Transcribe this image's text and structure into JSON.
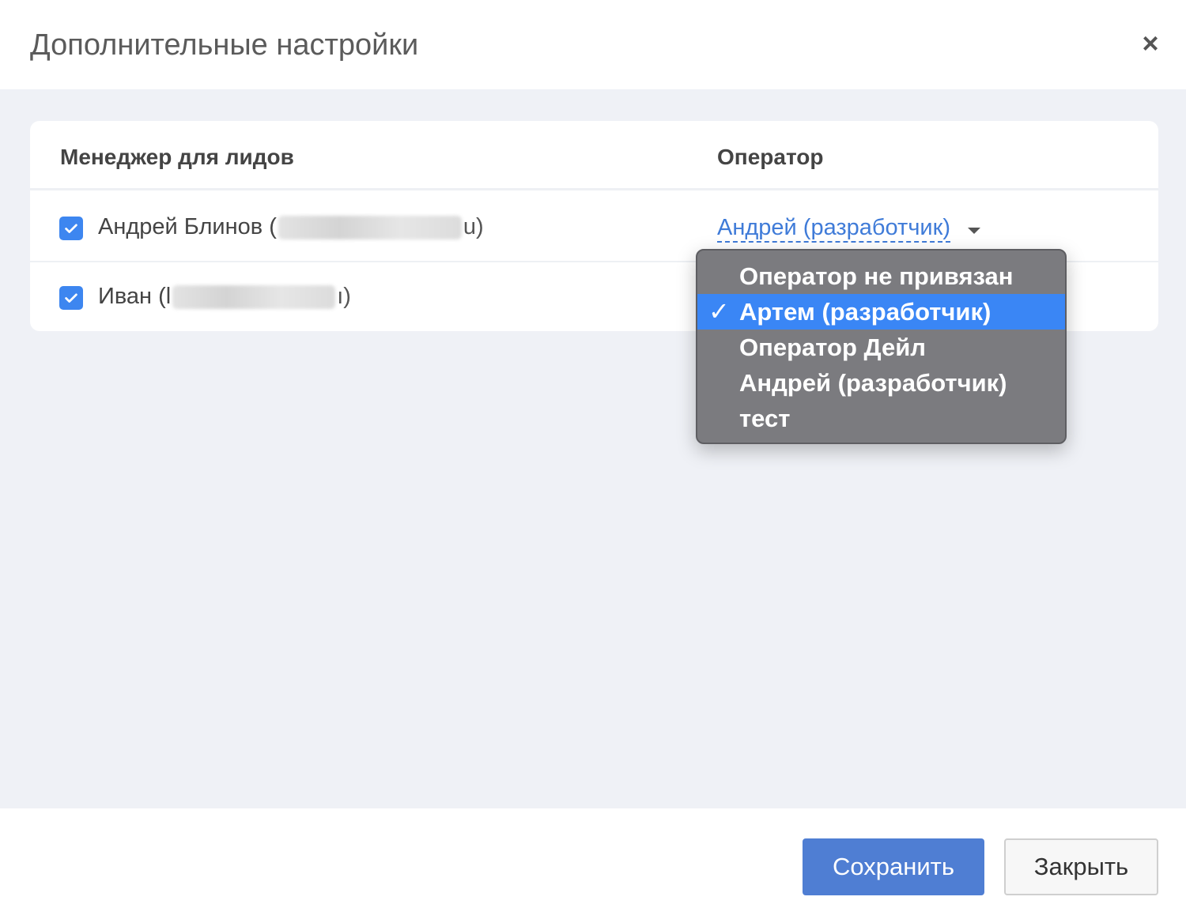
{
  "modal": {
    "title": "Дополнительные настройки",
    "close_glyph": "×"
  },
  "table": {
    "headers": {
      "manager": "Менеджер для лидов",
      "operator": "Оператор"
    },
    "rows": [
      {
        "checked": true,
        "name_prefix": "Андрей Блинов (",
        "name_suffix": "u)",
        "operator": "Андрей (разработчик)"
      },
      {
        "checked": true,
        "name_prefix": "Иван (l",
        "name_suffix": "ı)"
      }
    ]
  },
  "dropdown": {
    "check_glyph": "✓",
    "options": [
      "Оператор не привязан",
      "Артем (разработчик)",
      "Оператор Дейл",
      "Андрей (разработчик)",
      "тест"
    ],
    "selected_index": 1
  },
  "footer": {
    "save_label": "Сохранить",
    "close_label": "Закрыть"
  },
  "colors": {
    "accent": "#3d86f0",
    "link": "#3f7bd8",
    "save_button": "#4f7ed3",
    "body_bg": "#eff1f6"
  },
  "icons": {
    "close": "close-icon",
    "checkbox": "checkmark-icon",
    "caret": "caret-down-icon"
  }
}
